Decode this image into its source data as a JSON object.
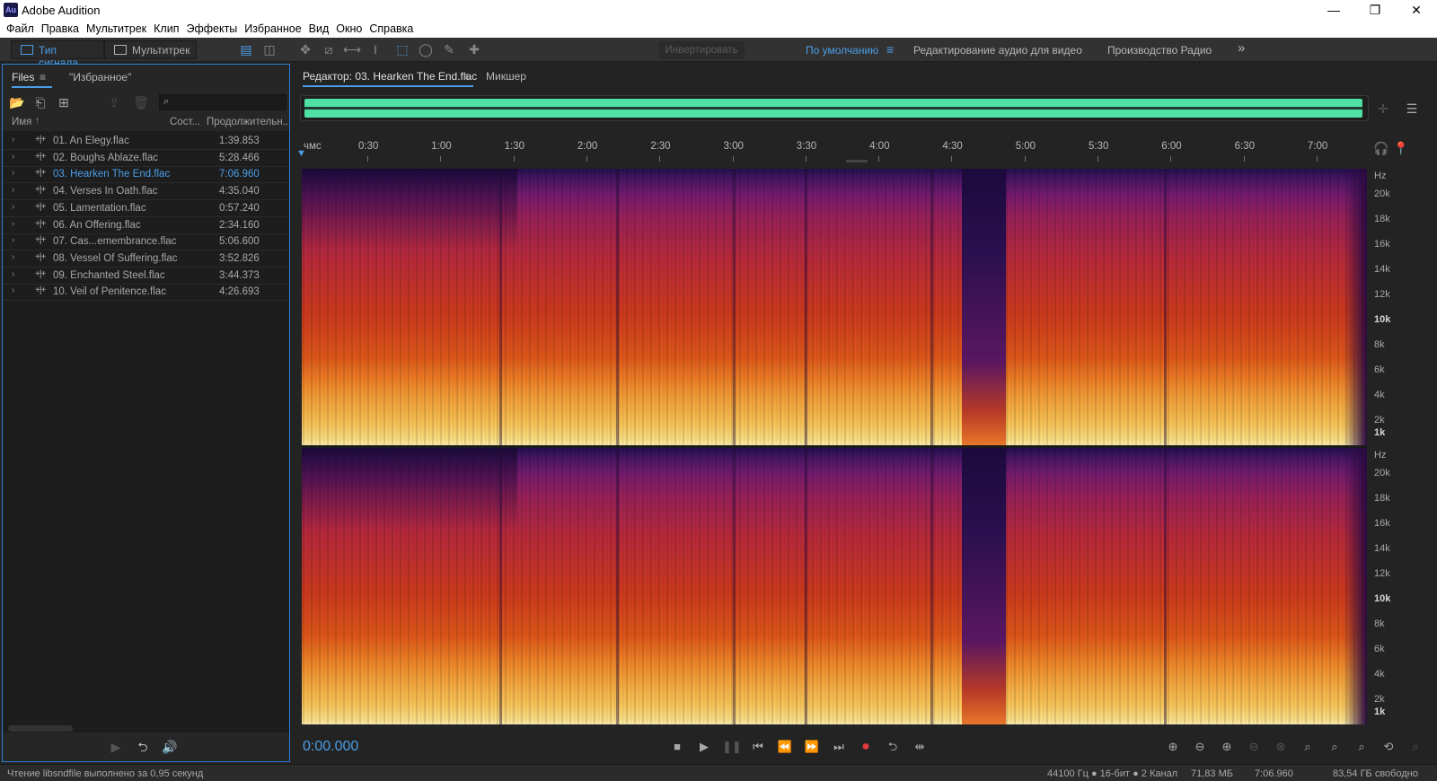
{
  "window": {
    "app_title": "Adobe Audition",
    "logo_text": "Au",
    "minimize": "—",
    "restore": "❐",
    "close": "✕"
  },
  "menu": [
    "Файл",
    "Правка",
    "Мультитрек",
    "Клип",
    "Эффекты",
    "Избранное",
    "Вид",
    "Окно",
    "Справка"
  ],
  "toolbar": {
    "mode_waveform": "Тип сигнала",
    "mode_multitrack": "Мультитрек",
    "invert_label": "Инвертировать",
    "workspaces": [
      "По умолчанию",
      "Редактирование аудио для видео",
      "Производство Радио"
    ],
    "more": "»"
  },
  "files_panel": {
    "tab_files": "Files",
    "tab_favorites": "\"Избранное\"",
    "col_name": "Имя",
    "col_status": "Сост...",
    "col_duration": "Продолжительн...",
    "files": [
      {
        "name": "01. An Elegy.flac",
        "duration": "1:39.853"
      },
      {
        "name": "02. Boughs Ablaze.flac",
        "duration": "5:28.466"
      },
      {
        "name": "03. Hearken The End.flac",
        "duration": "7:06.960"
      },
      {
        "name": "04. Verses In Oath.flac",
        "duration": "4:35.040"
      },
      {
        "name": "05. Lamentation.flac",
        "duration": "0:57.240"
      },
      {
        "name": "06. An Offering.flac",
        "duration": "2:34.160"
      },
      {
        "name": "07. Cas...emembrance.flac",
        "duration": "5:06.600"
      },
      {
        "name": "08. Vessel Of Suffering.flac",
        "duration": "3:52.826"
      },
      {
        "name": "09. Enchanted Steel.flac",
        "duration": "3:44.373"
      },
      {
        "name": "10. Veil of Penitence.flac",
        "duration": "4:26.693"
      }
    ],
    "selected_index": 2
  },
  "editor": {
    "tab_editor": "Редактор: 03. Hearken The End.flac",
    "tab_mixer": "Микшер",
    "ruler_unit": "чмс",
    "ruler_ticks": [
      "0:30",
      "1:00",
      "1:30",
      "2:00",
      "2:30",
      "3:00",
      "3:30",
      "4:00",
      "4:30",
      "5:00",
      "5:30",
      "6:00",
      "6:30",
      "7:00"
    ],
    "hz_label": "Hz",
    "freq_labels": [
      "20k",
      "18k",
      "16k",
      "14k",
      "12k",
      "10k",
      "8k",
      "6k",
      "4k",
      "2k",
      "1k"
    ],
    "bold_freqs": [
      "10k",
      "1k"
    ],
    "timecode": "0:00.000"
  },
  "status": {
    "message": "Чтение libsndfile выполнено за 0,95 секунд",
    "format": "44100 Гц ● 16-бит ● 2 Канал",
    "size": "71,83 МБ",
    "length": "7:06.960",
    "free": "83,54 ГБ свободно"
  },
  "colors": {
    "accent": "#4a9fe8",
    "overview_wave": "#4fe0a3",
    "record": "#e03a3a"
  }
}
